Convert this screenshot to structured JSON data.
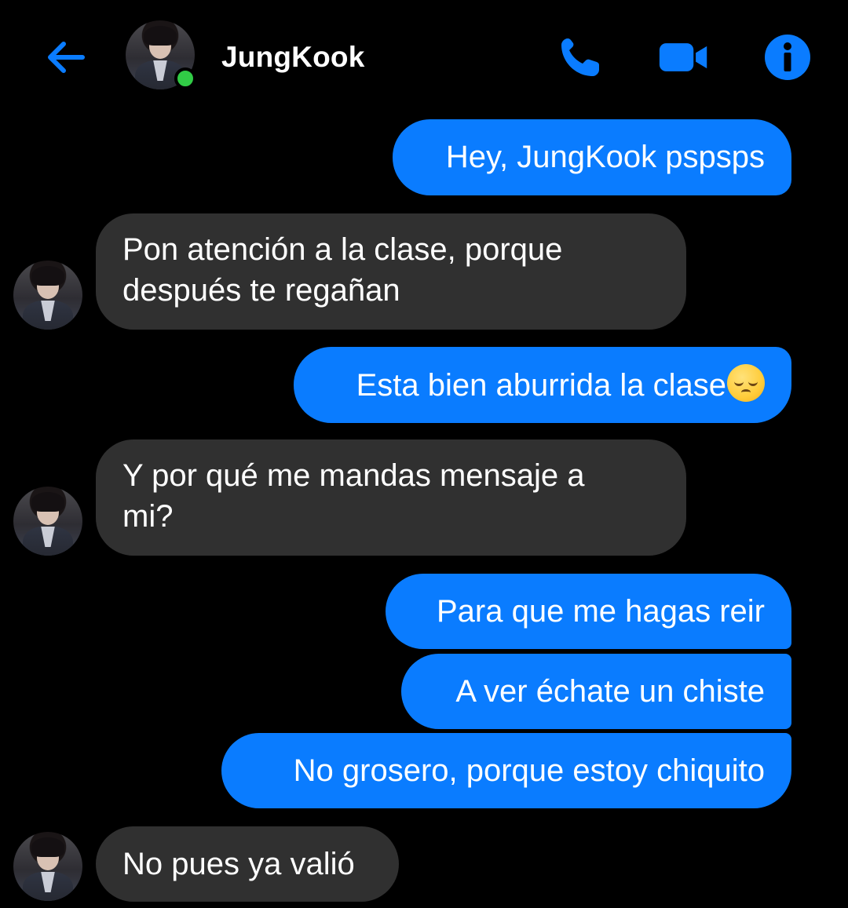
{
  "header": {
    "contact_name": "JungKook",
    "online": true,
    "icons": {
      "back": "arrow-left-icon",
      "call": "phone-icon",
      "video": "video-camera-icon",
      "info": "info-icon"
    },
    "accent_color": "#0a7cff"
  },
  "messages": [
    {
      "sender": "me",
      "lines": [
        "Hey, JungKook pspsps"
      ]
    },
    {
      "sender": "contact",
      "lines": [
        "Pon atención a la clase, porque",
        "después te regañan"
      ]
    },
    {
      "sender": "me",
      "lines": [
        "Esta bien aburrida la clase"
      ],
      "emoji": "pensive-face"
    },
    {
      "sender": "contact",
      "lines": [
        "Y por qué me mandas mensaje a",
        "mi?"
      ]
    },
    {
      "sender": "me",
      "lines": [
        "Para que me hagas reir"
      ]
    },
    {
      "sender": "me",
      "lines": [
        "A ver échate un chiste"
      ]
    },
    {
      "sender": "me",
      "lines": [
        "No grosero, porque estoy chiquito"
      ]
    },
    {
      "sender": "contact",
      "lines": [
        "No pues ya valió"
      ]
    }
  ],
  "colors": {
    "background": "#000000",
    "outgoing_bubble": "#0a7cff",
    "incoming_bubble": "#303030",
    "online_dot": "#31cc46"
  }
}
